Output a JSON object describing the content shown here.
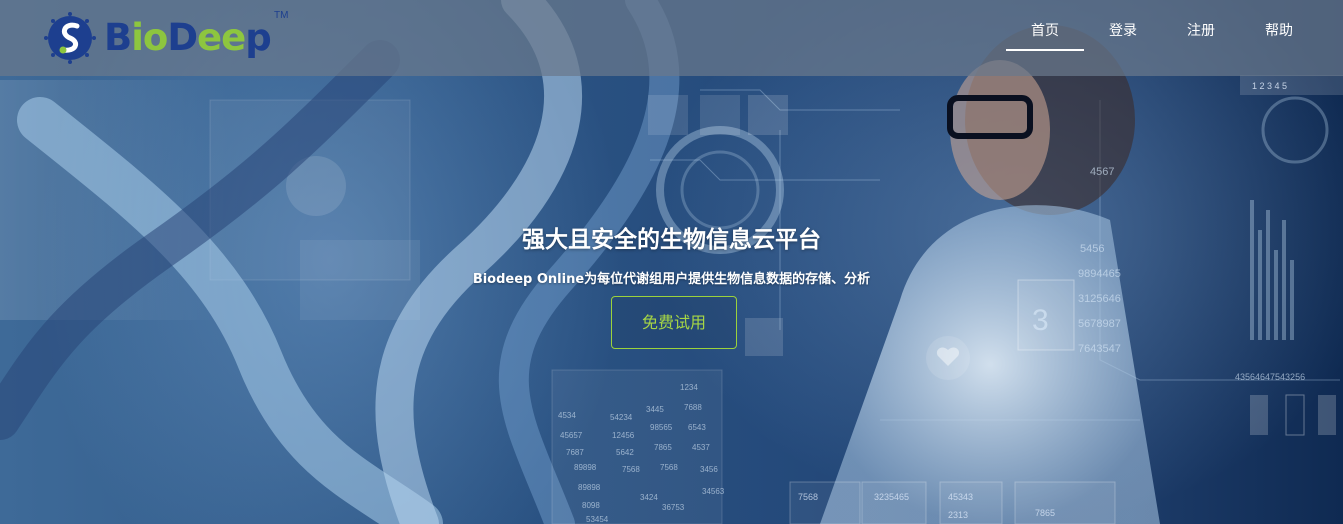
{
  "brand": {
    "logo_text_part1": "B",
    "logo_text_part2": "io",
    "logo_text_part3": "D",
    "logo_text_part4": "ee",
    "logo_text_part5": "p",
    "trademark": "TM"
  },
  "nav": {
    "items": [
      {
        "label": "首页",
        "active": true
      },
      {
        "label": "登录",
        "active": false
      },
      {
        "label": "注册",
        "active": false
      },
      {
        "label": "帮助",
        "active": false
      }
    ]
  },
  "hero": {
    "title": "强大且安全的生物信息云平台",
    "subtitle": "Biodeep Online为每位代谢组用户提供生物信息数据的存储、分析",
    "cta_label": "免费试用"
  },
  "background_numbers": {
    "right_column": [
      "4567",
      "5456",
      "9894465",
      "3125646",
      "5678987",
      "7643547"
    ],
    "right_small": "43564647543256",
    "panel_digit": "3",
    "bottom_values": [
      "45343",
      "2313",
      "7865",
      "7568",
      "3235465"
    ],
    "grid_values": [
      "4534",
      "45657",
      "7687",
      "89898",
      "89898",
      "8098",
      "53454",
      "54234",
      "12456",
      "5642",
      "7568",
      "3445",
      "98565",
      "7865",
      "7568",
      "1234",
      "7688",
      "6543",
      "4537",
      "3424",
      "36753",
      "3456",
      "34563"
    ],
    "top_right_digits": "1 2 3 4 5"
  },
  "colors": {
    "brand_blue": "#1d3f8f",
    "brand_green": "#8dc63f",
    "cta_green": "#a6d645",
    "header_overlay": "rgba(105,120,140,0.72)"
  }
}
